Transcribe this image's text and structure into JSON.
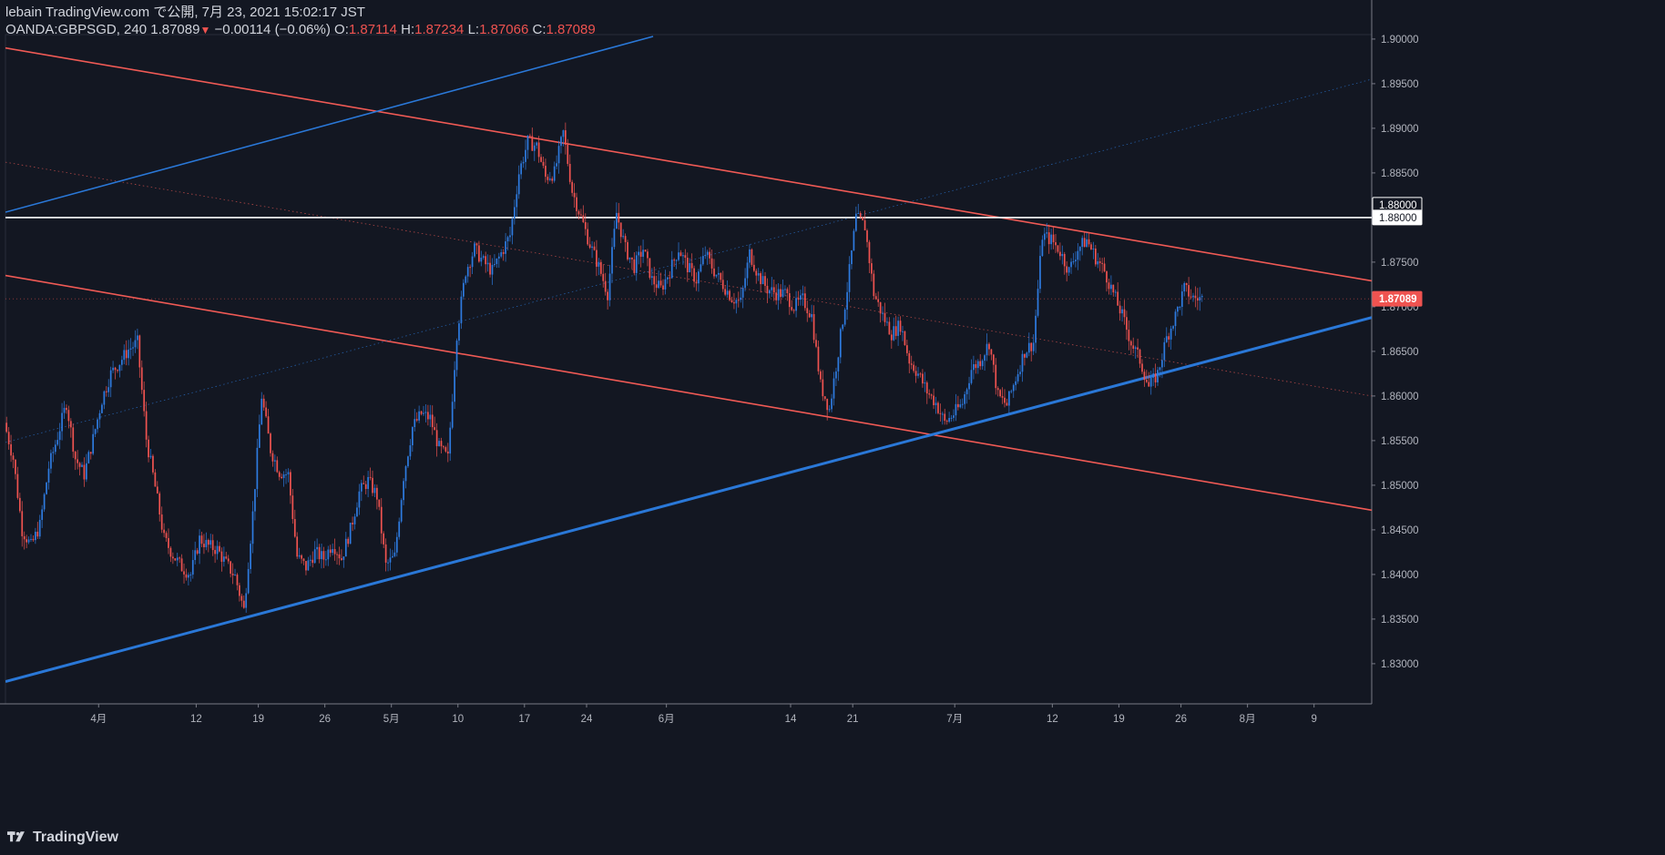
{
  "header": {
    "publisher": "lebain TradingView.com で公開, 7月 23, 2021 15:02:17 JST",
    "symbol": "OANDA:GBPSGD, 240",
    "last": "1.87089",
    "change": "−0.00114 (−0.06%)",
    "o_label": "O:",
    "o": "1.87114",
    "h_label": "H:",
    "h": "1.87234",
    "l_label": "L:",
    "l": "1.87066",
    "c_label": "C:",
    "c": "1.87089",
    "arrow_icon": "triangle-down-icon"
  },
  "footer": {
    "brand": "TradingView",
    "logo_icon": "tradingview-logo-icon"
  },
  "colors": {
    "background": "#131722",
    "up": "#2e7be0",
    "down": "#ef5350",
    "resistance": "#f05a55",
    "support": "#2a78d8",
    "level": "#ffffff",
    "axis_text": "#b2b5be",
    "grid": "#1e222d"
  },
  "chart_data": {
    "type": "candlestick",
    "y_ticks": [
      "1.90000",
      "1.89500",
      "1.89000",
      "1.88500",
      "1.88000",
      "1.87500",
      "1.87000",
      "1.86500",
      "1.86000",
      "1.85500",
      "1.85000",
      "1.84500",
      "1.84000",
      "1.83500",
      "1.83000"
    ],
    "x_ticks": [
      "4月",
      "12",
      "19",
      "26",
      "5月",
      "10",
      "17",
      "24",
      "6月",
      "14",
      "21",
      "7月",
      "12",
      "19",
      "26",
      "8月",
      "9"
    ],
    "ylim": [
      1.8255,
      1.9005
    ],
    "price_labels": [
      {
        "text": "1.88000",
        "value": 1.88,
        "style": "white-outline",
        "role": "alert"
      },
      {
        "text": "1.88000",
        "value": 1.88,
        "style": "white",
        "role": "horizontal-line"
      },
      {
        "text": "1.87089",
        "value": 1.87089,
        "style": "last-price",
        "role": "last"
      }
    ],
    "horizontal_line": {
      "value": 1.88
    },
    "channels": [
      {
        "name": "",
        "color": "resistance",
        "lines": [
          {
            "x1": 0,
            "y1": 1.899,
            "x2": 154,
            "y2": 1.8729
          },
          {
            "x1": 0,
            "y1": 1.8735,
            "x2": 154,
            "y2": 1.8472
          }
        ],
        "mid": {
          "x1": 0,
          "y1": 1.8862,
          "x2": 154,
          "y2": 1.86
        }
      },
      {
        "name": "",
        "color": "support",
        "lines": [
          {
            "x1": 0,
            "y1": 1.828,
            "x2": 154,
            "y2": 1.8688
          },
          {
            "x1": 0,
            "y1": 1.8806,
            "x2": 73,
            "y2": 1.9003
          }
        ],
        "mid": {
          "x1": 0,
          "y1": 1.8548,
          "x2": 154,
          "y2": 1.8955
        }
      }
    ],
    "tick_x": [
      10.5,
      21.5,
      28.5,
      36,
      43.5,
      51,
      58.5,
      65.5,
      74.5,
      88.5,
      95.5,
      107,
      118,
      125.5,
      132.5,
      140,
      147.5
    ],
    "x_range": [
      0,
      154
    ],
    "path": [
      [
        0,
        1.857
      ],
      [
        1,
        1.853
      ],
      [
        2,
        1.845
      ],
      [
        3,
        1.8432
      ],
      [
        4,
        1.8455
      ],
      [
        5,
        1.852
      ],
      [
        6,
        1.8555
      ],
      [
        7,
        1.8592
      ],
      [
        8,
        1.853
      ],
      [
        9,
        1.8512
      ],
      [
        10,
        1.8552
      ],
      [
        11,
        1.8596
      ],
      [
        12,
        1.8625
      ],
      [
        13,
        1.8638
      ],
      [
        14,
        1.8652
      ],
      [
        15,
        1.866
      ],
      [
        16,
        1.8552
      ],
      [
        17,
        1.8498
      ],
      [
        18,
        1.844
      ],
      [
        19,
        1.8422
      ],
      [
        20,
        1.8408
      ],
      [
        21,
        1.84
      ],
      [
        22,
        1.844
      ],
      [
        23,
        1.8432
      ],
      [
        24,
        1.8428
      ],
      [
        25,
        1.8412
      ],
      [
        26,
        1.8398
      ],
      [
        27,
        1.836
      ],
      [
        28,
        1.8468
      ],
      [
        29,
        1.86
      ],
      [
        30,
        1.854
      ],
      [
        31,
        1.8515
      ],
      [
        32,
        1.8512
      ],
      [
        33,
        1.842
      ],
      [
        34,
        1.8408
      ],
      [
        35,
        1.8425
      ],
      [
        36,
        1.8418
      ],
      [
        37,
        1.8435
      ],
      [
        38,
        1.8418
      ],
      [
        39,
        1.845
      ],
      [
        40,
        1.8492
      ],
      [
        41,
        1.8505
      ],
      [
        42,
        1.8488
      ],
      [
        43,
        1.841
      ],
      [
        44,
        1.842
      ],
      [
        45,
        1.851
      ],
      [
        46,
        1.8565
      ],
      [
        47,
        1.858
      ],
      [
        48,
        1.8575
      ],
      [
        49,
        1.8542
      ],
      [
        50,
        1.853
      ],
      [
        51,
        1.867
      ],
      [
        52,
        1.874
      ],
      [
        53,
        1.8765
      ],
      [
        54,
        1.875
      ],
      [
        55,
        1.874
      ],
      [
        56,
        1.876
      ],
      [
        57,
        1.878
      ],
      [
        58,
        1.885
      ],
      [
        59,
        1.8885
      ],
      [
        60,
        1.888
      ],
      [
        61,
        1.8845
      ],
      [
        62,
        1.885
      ],
      [
        63,
        1.8895
      ],
      [
        64,
        1.883
      ],
      [
        65,
        1.88
      ],
      [
        66,
        1.877
      ],
      [
        67,
        1.8745
      ],
      [
        68,
        1.8715
      ],
      [
        69,
        1.8805
      ],
      [
        70,
        1.8765
      ],
      [
        71,
        1.8745
      ],
      [
        72,
        1.8765
      ],
      [
        73,
        1.873
      ],
      [
        74,
        1.872
      ],
      [
        75,
        1.874
      ],
      [
        76,
        1.8765
      ],
      [
        77,
        1.8745
      ],
      [
        78,
        1.873
      ],
      [
        79,
        1.876
      ],
      [
        80,
        1.874
      ],
      [
        81,
        1.8725
      ],
      [
        82,
        1.871
      ],
      [
        83,
        1.8705
      ],
      [
        84,
        1.876
      ],
      [
        85,
        1.8735
      ],
      [
        86,
        1.872
      ],
      [
        87,
        1.8715
      ],
      [
        88,
        1.8715
      ],
      [
        89,
        1.87
      ],
      [
        90,
        1.8708
      ],
      [
        91,
        1.869
      ],
      [
        92,
        1.8612
      ],
      [
        93,
        1.8585
      ],
      [
        94,
        1.865
      ],
      [
        95,
        1.872
      ],
      [
        96,
        1.88
      ],
      [
        97,
        1.879
      ],
      [
        98,
        1.8715
      ],
      [
        99,
        1.869
      ],
      [
        100,
        1.867
      ],
      [
        101,
        1.868
      ],
      [
        102,
        1.864
      ],
      [
        103,
        1.8625
      ],
      [
        104,
        1.8605
      ],
      [
        105,
        1.8592
      ],
      [
        106,
        1.857
      ],
      [
        107,
        1.858
      ],
      [
        108,
        1.8592
      ],
      [
        109,
        1.863
      ],
      [
        110,
        1.864
      ],
      [
        111,
        1.866
      ],
      [
        112,
        1.86
      ],
      [
        113,
        1.859
      ],
      [
        114,
        1.862
      ],
      [
        115,
        1.865
      ],
      [
        116,
        1.866
      ],
      [
        117,
        1.878
      ],
      [
        118,
        1.8775
      ],
      [
        119,
        1.8762
      ],
      [
        120,
        1.874
      ],
      [
        121,
        1.8765
      ],
      [
        122,
        1.8775
      ],
      [
        123,
        1.8755
      ],
      [
        124,
        1.874
      ],
      [
        125,
        1.8715
      ],
      [
        126,
        1.869
      ],
      [
        127,
        1.866
      ],
      [
        128,
        1.864
      ],
      [
        129,
        1.861
      ],
      [
        130,
        1.8625
      ],
      [
        131,
        1.8665
      ],
      [
        132,
        1.869
      ],
      [
        133,
        1.872
      ],
      [
        134,
        1.871
      ],
      [
        135,
        1.87089
      ]
    ]
  }
}
